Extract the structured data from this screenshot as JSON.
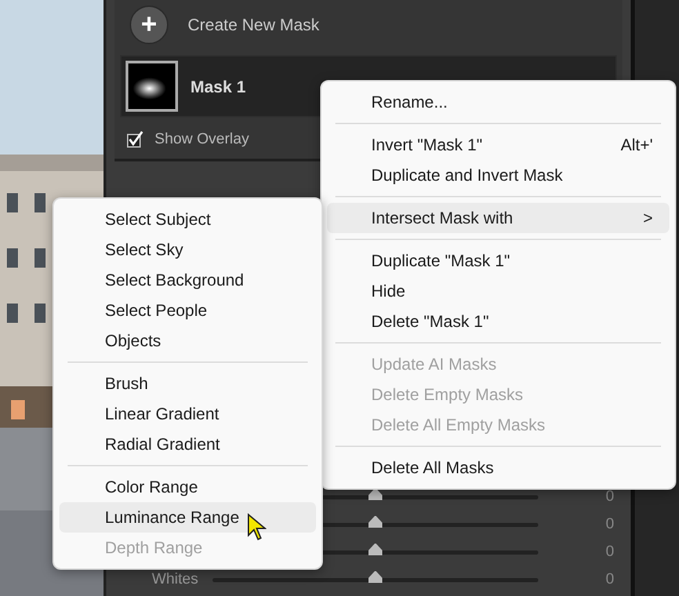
{
  "panel": {
    "create_button": {
      "icon": "+",
      "label": "Create New Mask"
    },
    "masks": [
      {
        "name": "Mask 1",
        "selected": true
      }
    ],
    "show_overlay": {
      "label": "Show Overlay",
      "checked": true
    },
    "sliders": [
      {
        "value": "0",
        "level": 0.5
      },
      {
        "value": "0",
        "level": 0.5
      },
      {
        "value": "0",
        "level": 0.5
      },
      {
        "label": "Whites",
        "value": "0",
        "level": 0.5
      }
    ]
  },
  "context_menu": {
    "items": [
      {
        "kind": "item",
        "label": "Rename...",
        "highlighted": false,
        "disabled": false
      },
      {
        "kind": "separator"
      },
      {
        "kind": "item",
        "label": "Invert \"Mask 1\"",
        "shortcut": "Alt+'",
        "highlighted": false,
        "disabled": false
      },
      {
        "kind": "item",
        "label": "Duplicate and Invert Mask",
        "highlighted": false,
        "disabled": false
      },
      {
        "kind": "separator"
      },
      {
        "kind": "item",
        "label": "Intersect Mask with",
        "submenu_arrow": ">",
        "highlighted": true,
        "disabled": false
      },
      {
        "kind": "separator"
      },
      {
        "kind": "item",
        "label": "Duplicate \"Mask 1\"",
        "highlighted": false,
        "disabled": false
      },
      {
        "kind": "item",
        "label": "Hide",
        "highlighted": false,
        "disabled": false
      },
      {
        "kind": "item",
        "label": "Delete \"Mask 1\"",
        "highlighted": false,
        "disabled": false
      },
      {
        "kind": "separator"
      },
      {
        "kind": "item",
        "label": "Update AI Masks",
        "highlighted": false,
        "disabled": true
      },
      {
        "kind": "item",
        "label": "Delete Empty Masks",
        "highlighted": false,
        "disabled": true
      },
      {
        "kind": "item",
        "label": "Delete All Empty Masks",
        "highlighted": false,
        "disabled": true
      },
      {
        "kind": "separator"
      },
      {
        "kind": "item",
        "label": "Delete All Masks",
        "highlighted": false,
        "disabled": false
      }
    ]
  },
  "submenu": {
    "items": [
      {
        "kind": "item",
        "label": "Select Subject",
        "highlighted": false,
        "disabled": false
      },
      {
        "kind": "item",
        "label": "Select Sky",
        "highlighted": false,
        "disabled": false
      },
      {
        "kind": "item",
        "label": "Select Background",
        "highlighted": false,
        "disabled": false
      },
      {
        "kind": "item",
        "label": "Select People",
        "highlighted": false,
        "disabled": false
      },
      {
        "kind": "item",
        "label": "Objects",
        "highlighted": false,
        "disabled": false
      },
      {
        "kind": "separator"
      },
      {
        "kind": "item",
        "label": "Brush",
        "highlighted": false,
        "disabled": false
      },
      {
        "kind": "item",
        "label": "Linear Gradient",
        "highlighted": false,
        "disabled": false
      },
      {
        "kind": "item",
        "label": "Radial Gradient",
        "highlighted": false,
        "disabled": false
      },
      {
        "kind": "separator"
      },
      {
        "kind": "item",
        "label": "Color Range",
        "highlighted": false,
        "disabled": false
      },
      {
        "kind": "item",
        "label": "Luminance Range",
        "highlighted": true,
        "disabled": false
      },
      {
        "kind": "item",
        "label": "Depth Range",
        "highlighted": false,
        "disabled": true
      }
    ]
  }
}
